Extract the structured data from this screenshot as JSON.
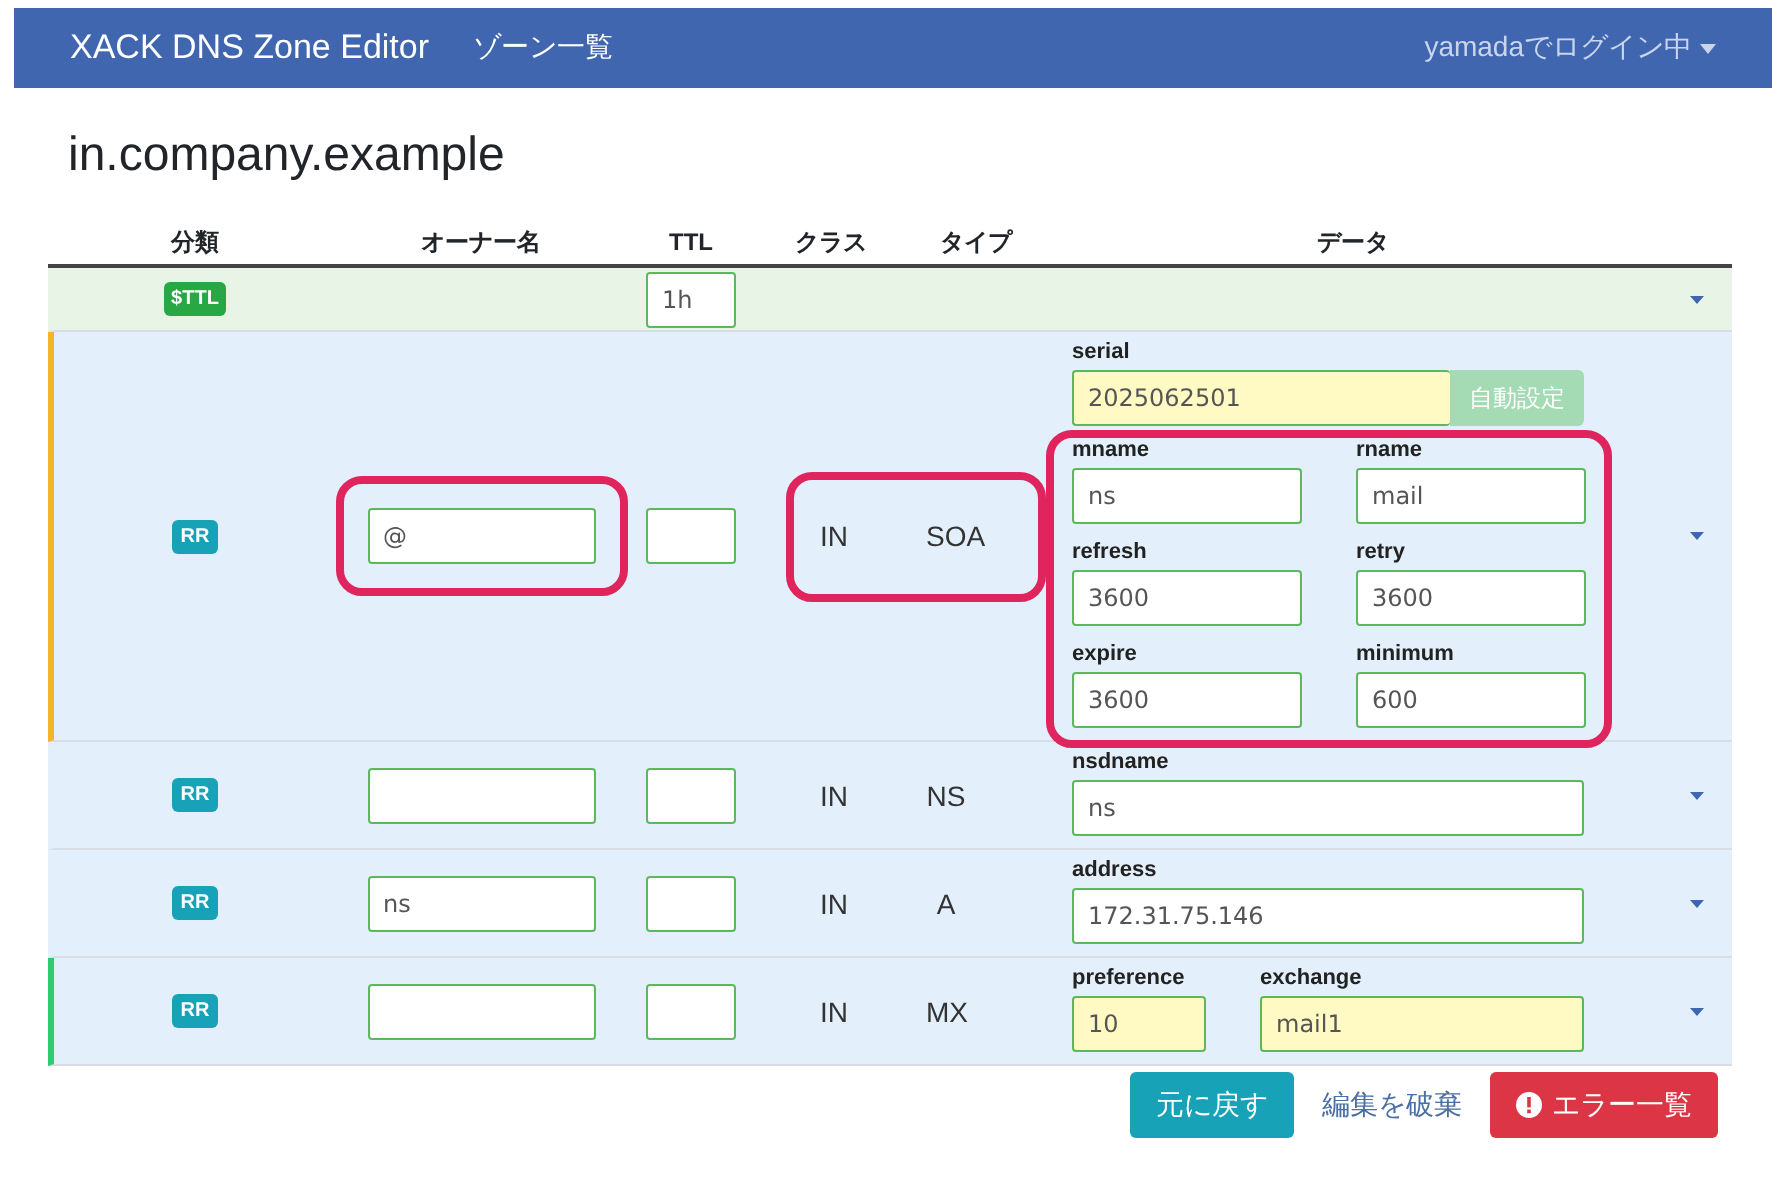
{
  "navbar": {
    "brand": "XACK DNS Zone Editor",
    "links": [
      {
        "label": "ゾーン一覧"
      }
    ],
    "user_menu": "yamadaでログイン中"
  },
  "zone_title": "in.company.example",
  "table": {
    "columns": [
      "分類",
      "オーナー名",
      "TTL",
      "クラス",
      "タイプ",
      "データ"
    ],
    "records": [
      {
        "kind": "ttl",
        "badge": "$TTL",
        "ttl": "1h"
      },
      {
        "kind": "rr",
        "badge": "RR",
        "color": "#f5b42a",
        "owner": "@",
        "owner_highlighted": true,
        "class": "IN",
        "type": "SOA",
        "class_type_highlighted": true,
        "data": {
          "kind": "soa",
          "serial": {
            "label": "serial",
            "value": "2025062501",
            "changed": true
          },
          "auto_button": {
            "label": "自動設定",
            "disabled": true
          },
          "fields_highlighted": true,
          "fields": [
            {
              "label": "mname",
              "value": "ns",
              "changed": false
            },
            {
              "label": "rname",
              "value": "mail",
              "changed": false
            },
            {
              "label": "refresh",
              "value": "3600",
              "changed": false
            },
            {
              "label": "retry",
              "value": "3600",
              "changed": false
            },
            {
              "label": "expire",
              "value": "3600",
              "changed": false
            },
            {
              "label": "minimum",
              "value": "600",
              "changed": false
            }
          ]
        }
      },
      {
        "kind": "rr",
        "badge": "RR",
        "class": "IN",
        "type": "NS",
        "data": {
          "kind": "single",
          "fields": [
            {
              "label": "nsdname",
              "value": "ns",
              "changed": false
            }
          ]
        }
      },
      {
        "kind": "rr",
        "badge": "RR",
        "owner": "ns",
        "class": "IN",
        "type": "A",
        "data": {
          "kind": "single",
          "fields": [
            {
              "label": "address",
              "value": "172.31.75.146",
              "changed": false
            }
          ]
        }
      },
      {
        "kind": "rr",
        "badge": "RR",
        "color": "#2ecc71",
        "class": "IN",
        "type": "MX",
        "data": {
          "kind": "pair",
          "fields": [
            {
              "label": "preference",
              "value": "10",
              "changed": true
            },
            {
              "label": "exchange",
              "value": "mail1",
              "changed": true
            }
          ]
        }
      }
    ]
  },
  "actions": [
    {
      "kind": "revert",
      "label": "元に戻す"
    },
    {
      "kind": "discard",
      "label": "編集を破棄"
    },
    {
      "kind": "errors",
      "label": "エラー一覧"
    }
  ]
}
